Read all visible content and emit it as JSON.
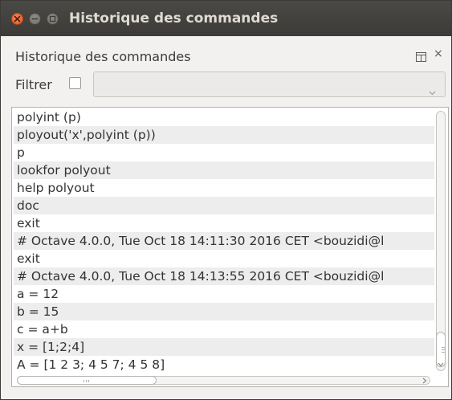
{
  "window": {
    "title": "Historique des commandes"
  },
  "dock": {
    "title": "Historique des commandes",
    "close_label": "×"
  },
  "filter": {
    "label": "Filtrer",
    "checked": false,
    "value": ""
  },
  "history": {
    "items": [
      "polyint (p)",
      "ployout('x',polyint (p))",
      "p",
      "lookfor polyout",
      "help polyout",
      "doc",
      "exit",
      "# Octave 4.0.0, Tue Oct 18 14:11:30 2016 CET <bouzidi@l",
      "exit",
      "# Octave 4.0.0, Tue Oct 18 14:13:55 2016 CET <bouzidi@l",
      "a = 12",
      "b = 15",
      "c = a+b",
      "x = [1;2;4]",
      "A = [1 2 3; 4 5 7; 4 5 8]"
    ]
  },
  "icons": {
    "window_close": "close-icon",
    "window_minimize": "minimize-icon",
    "window_maximize": "maximize-icon",
    "undock": "undock-icon",
    "combo_arrow": "chevron-down-icon"
  },
  "colors": {
    "titlebar": "#3c3b37",
    "close_button": "#e1571f",
    "row_alt": "#ededed"
  }
}
